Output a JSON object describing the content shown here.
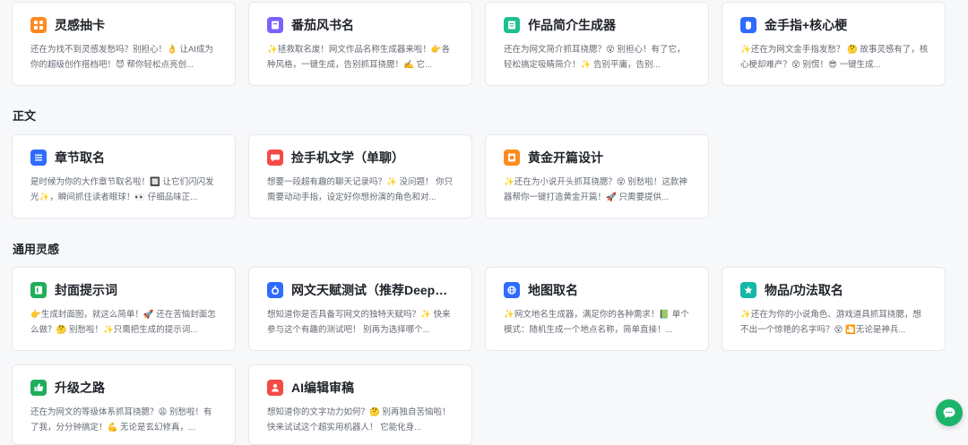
{
  "top_cards": [
    {
      "title": "灵感抽卡",
      "desc": "还在为找不到灵感发愁吗？别担心！👌 让AI成为你的超级创作搭档吧！😈 帮你轻松点亮创...",
      "icon": "grid-icon",
      "color": "#ff8a1f"
    },
    {
      "title": "番茄风书名",
      "desc": "✨拯救取名废！网文作品名称生成器来啦！👉各种风格，一键生成，告别抓耳挠腮！✍️ 它...",
      "icon": "book-icon",
      "color": "#7b61ff"
    },
    {
      "title": "作品简介生成器",
      "desc": "还在为网文简介抓耳挠腮？😵 别担心！有了它，轻松搞定吸睛简介！✨ 告别平庸，告别...",
      "icon": "document-icon",
      "color": "#1fbf8f"
    },
    {
      "title": "金手指+核心梗",
      "desc": "✨还在为网文金手指发愁？ 🤔 故事灵感有了，核心梗却难产？😵 别慌！😎 一键生成...",
      "icon": "hand-icon",
      "color": "#2f6bff"
    }
  ],
  "sections": {
    "main_text": "正文",
    "general": "通用灵感"
  },
  "mid_cards": [
    {
      "title": "章节取名",
      "desc": "是时候为你的大作章节取名啦！🔲 让它们闪闪发光✨，瞬间抓住读者眼球！👀 仔细品味正...",
      "icon": "list-icon",
      "color": "#2f6bff"
    },
    {
      "title": "捡手机文学（单聊）",
      "desc": "想要一段超有趣的聊天记录吗？✨ 没问题！ 你只需要动动手指，设定好你想扮演的角色和对...",
      "icon": "chat-icon",
      "color": "#f54a45"
    },
    {
      "title": "黄金开篇设计",
      "desc": "✨还在为小说开头抓耳挠腮？😵 别愁啦！这款神器帮你一键打造黄金开篇！🚀 只需要提供...",
      "icon": "page-icon",
      "color": "#ff8a1f"
    }
  ],
  "general_cards": [
    {
      "title": "封面提示词",
      "desc": "👉生成封面图，就这么简单！🚀 还在苦恼封面怎么做？🤔 别愁啦！✨只需把生成的提示词...",
      "icon": "cover-icon",
      "color": "#1fae5a"
    },
    {
      "title": "网文天赋测试（推荐DeepSeek）",
      "desc": "想知道你是否具备写网文的独特天赋吗？✨ 快来参与这个有趣的测试吧！ 别再为选择哪个...",
      "icon": "test-icon",
      "color": "#2f6bff"
    },
    {
      "title": "地图取名",
      "desc": "✨网文地名生成器，满足你的各种需求！📗 单个模式：随机生成一个地点名称，简单直接！...",
      "icon": "globe-icon",
      "color": "#2f6bff"
    },
    {
      "title": "物品/功法取名",
      "desc": "✨还在为你的小说角色、游戏道具抓耳挠腮，想不出一个惊艳的名字吗？😵 🎦无论是神兵...",
      "icon": "star-icon",
      "color": "#14b8a6"
    }
  ],
  "bottom_cards": [
    {
      "title": "升级之路",
      "desc": "还在为网文的等级体系抓耳挠腮？😩 别愁啦！有了我，分分钟搞定！💪 无论是玄幻修真，...",
      "icon": "thumb-up-icon",
      "color": "#1fae5a"
    },
    {
      "title": "AI编辑审稿",
      "desc": "想知道你的文字功力如何？🤔 别再独自苦恼啦！快来试试这个超实用机器人！ 它能化身...",
      "icon": "editor-icon",
      "color": "#f54a45"
    }
  ],
  "chat_button": {
    "icon": "chat-bubble-icon"
  }
}
